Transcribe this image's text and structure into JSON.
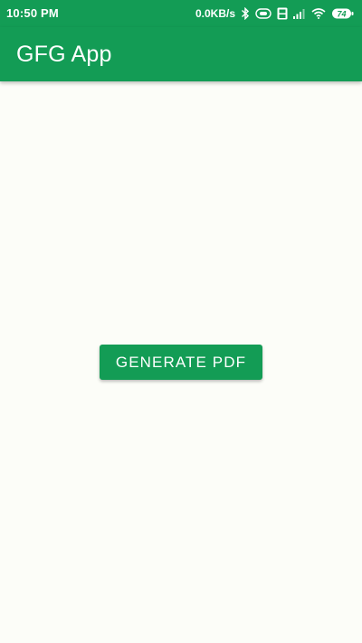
{
  "status_bar": {
    "time": "10:50 PM",
    "net_speed": "0.0KB/s",
    "battery_level": "74",
    "icons": [
      "bluetooth-icon",
      "hd-voice-icon",
      "volte-icon",
      "cell-signal-icon",
      "wifi-icon",
      "battery-icon"
    ]
  },
  "app_bar": {
    "title": "GFG App",
    "color": "#139c55"
  },
  "main": {
    "generate_button_label": "GENERATE PDF",
    "background": "#fcfdf8"
  }
}
